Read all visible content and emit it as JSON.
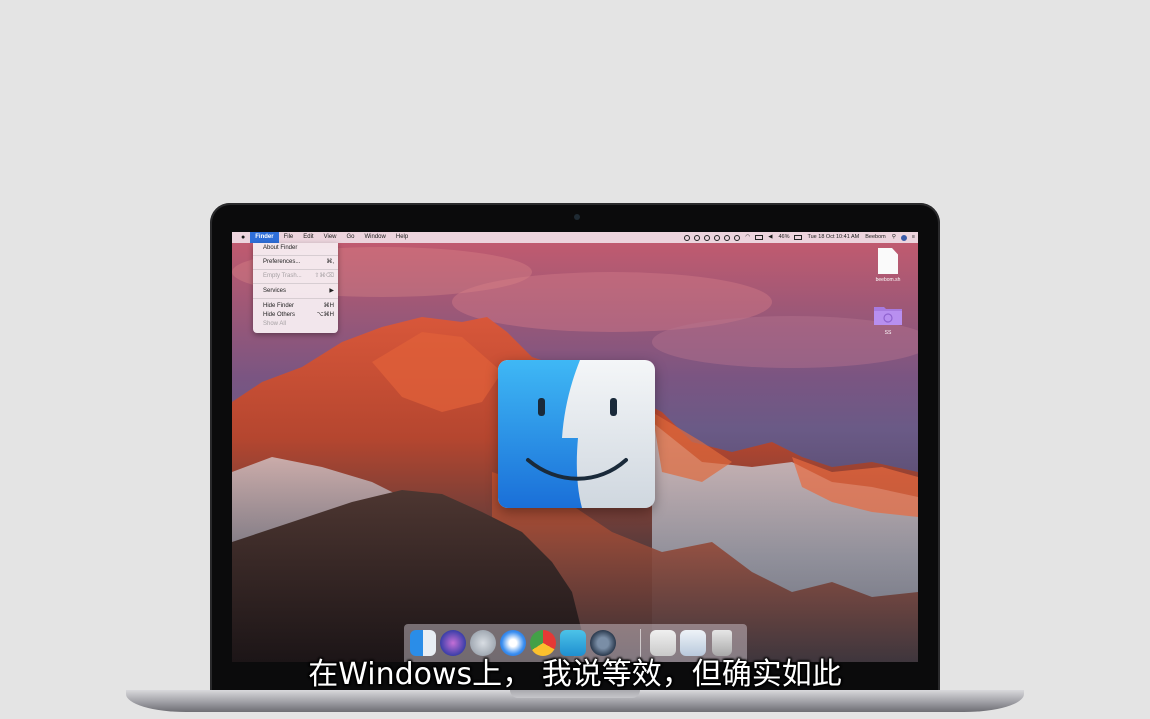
{
  "menubar": {
    "apple": "",
    "items": [
      "Finder",
      "File",
      "Edit",
      "View",
      "Go",
      "Window",
      "Help"
    ],
    "battery": "46%",
    "datetime": "Tue 18 Oct 10:41 AM",
    "user": "Beebom"
  },
  "finder_menu": {
    "items": [
      {
        "label": "About Finder",
        "shortcut": "",
        "disabled": false
      },
      {
        "label": "Preferences...",
        "shortcut": "⌘,",
        "disabled": false
      },
      {
        "label": "Empty Trash...",
        "shortcut": "⇧⌘⌫",
        "disabled": true
      },
      {
        "label": "Services",
        "shortcut": "▶",
        "disabled": false
      },
      {
        "label": "Hide Finder",
        "shortcut": "⌘H",
        "disabled": false
      },
      {
        "label": "Hide Others",
        "shortcut": "⌥⌘H",
        "disabled": false
      },
      {
        "label": "Show All",
        "shortcut": "",
        "disabled": true
      }
    ]
  },
  "desktop": {
    "file_label": "beebom.sh",
    "folder_label": "SS"
  },
  "dock": {
    "apps": [
      "finder-icon",
      "siri-icon",
      "launchpad-icon",
      "safari-icon",
      "chrome-icon",
      "quicktime-icon",
      "quicktime-x-icon",
      "preview-icon",
      "screenshot-icon",
      "trash-icon"
    ]
  },
  "subtitle": "在Windows上， 我说等效，但确实如此",
  "colors": {
    "menu_highlight": "#2f6fd9",
    "finder_blue": "#1e88e5",
    "finder_light": "#e8eef4"
  }
}
